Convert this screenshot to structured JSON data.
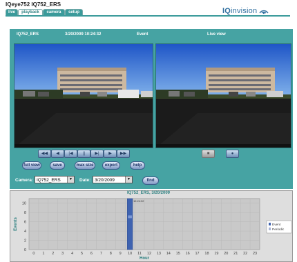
{
  "header": {
    "product": "IQeye752",
    "device": "IQ752_ERS",
    "tabs": [
      {
        "label": "live",
        "active": false
      },
      {
        "label": "playback",
        "active": true
      },
      {
        "label": "camera",
        "active": false
      },
      {
        "label": "setup",
        "active": false
      }
    ],
    "logo": {
      "iq": "IQ",
      "rest": "invision"
    }
  },
  "viewer": {
    "left": {
      "camera": "IQ752_ERS",
      "timestamp": "3/20/2009 10:24:32",
      "mode": "Event"
    },
    "right": {
      "title": "Live view"
    }
  },
  "playback": {
    "buttons": [
      "◀◀",
      "◀",
      "|◀",
      "||",
      "▶|",
      "▶",
      "▶▶"
    ],
    "right_buttons": [
      "■",
      "●"
    ]
  },
  "actions": [
    "full view",
    "save",
    "max size",
    "export",
    "help"
  ],
  "select": {
    "camera_label": "Camera:",
    "camera_value": "IQ752_ERS",
    "date_label": "Date:",
    "date_value": "3/20/2009",
    "find_label": "find"
  },
  "chart_data": {
    "type": "bar",
    "title": "IQ752_ERS, 3/20/2009",
    "xlabel": "Hour",
    "ylabel": "Events",
    "x": [
      0,
      1,
      2,
      3,
      4,
      5,
      6,
      7,
      8,
      9,
      10,
      11,
      12,
      13,
      14,
      15,
      16,
      17,
      18,
      19,
      20,
      21,
      22,
      23
    ],
    "ylim": [
      0,
      11
    ],
    "yticks": [
      0,
      2,
      4,
      6,
      8,
      10
    ],
    "series": [
      {
        "name": "Event",
        "color": "#3f63b0",
        "values": [
          0,
          0,
          0,
          0,
          0,
          0,
          0,
          0,
          0,
          0,
          11,
          0,
          0,
          0,
          0,
          0,
          0,
          0,
          0,
          0,
          0,
          0,
          0,
          0
        ]
      },
      {
        "name": "Periodic",
        "color": "#a8b4d6",
        "values": [
          0,
          0,
          0,
          0,
          0,
          0,
          0,
          0,
          0,
          0,
          0,
          0,
          0,
          0,
          0,
          0,
          0,
          0,
          0,
          0,
          0,
          0,
          0,
          0
        ]
      }
    ],
    "marker_label": "10:24:32",
    "grid": true,
    "legend": "right"
  }
}
